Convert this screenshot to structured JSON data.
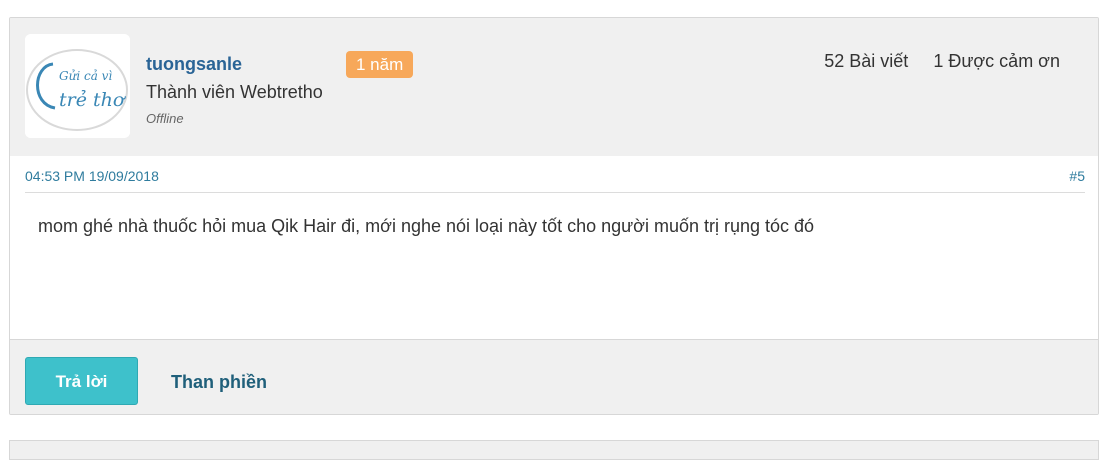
{
  "post": {
    "user": {
      "username": "tuongsanle",
      "badge": "1 năm",
      "rank": "Thành viên Webtretho",
      "status": "Offline",
      "avatar_text_line1": "Gửi cả vì",
      "avatar_text_line2": "trẻ thơ"
    },
    "stats": {
      "posts": "52 Bài viết",
      "thanks": "1 Được cảm ơn"
    },
    "timestamp": "04:53 PM 19/09/2018",
    "post_number": "#5",
    "content": "mom ghé nhà thuốc hỏi mua Qik Hair đi, mới nghe nói loại này tốt cho người muốn trị rụng tóc đó"
  },
  "actions": {
    "reply_label": "Trả lời",
    "complain_label": "Than phiền"
  },
  "colors": {
    "accent": "#3ec1cb",
    "badge": "#f7a85a",
    "link": "#2a6496"
  }
}
